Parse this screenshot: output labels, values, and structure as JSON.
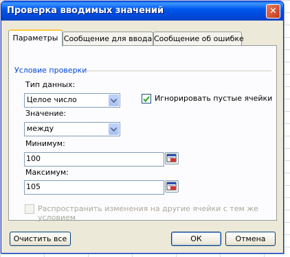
{
  "dialog": {
    "title": "Проверка вводимых значений",
    "close_glyph": "✕"
  },
  "tabs": [
    {
      "label": "Параметры",
      "active": true
    },
    {
      "label": "Сообщение для ввода",
      "active": false
    },
    {
      "label": "Сообщение об ошибке",
      "active": false
    }
  ],
  "criteria": {
    "group_title": "Условие проверки",
    "data_type_label": "Тип данных:",
    "data_type_value": "Целое число",
    "ignore_blank_label": "Игнорировать пустые ячейки",
    "ignore_blank_checked": true,
    "value_label": "Значение:",
    "value_value": "между",
    "minimum_label": "Минимум:",
    "minimum_value": "100",
    "maximum_label": "Максимум:",
    "maximum_value": "105",
    "apply_all_label": "Распространить изменения на другие ячейки с тем же условием",
    "apply_all_checked": false
  },
  "buttons": {
    "clear_all": "Очистить все",
    "ok": "ОК",
    "cancel": "Отмена"
  },
  "icons": {
    "dropdown": "chevron-down-icon",
    "ref_collapse": "collapse-dialog-icon",
    "checkmark": "checkmark-icon"
  },
  "colors": {
    "titlebar": "#0058ee",
    "dialog_bg": "#ece9d8",
    "group_title": "#0046d5",
    "checkmark": "#21a121"
  }
}
